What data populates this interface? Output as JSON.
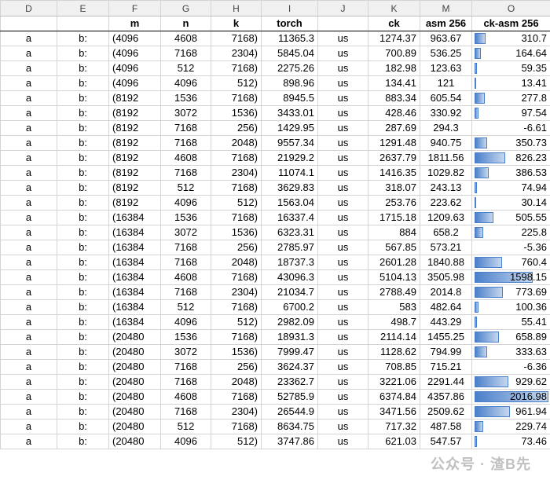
{
  "column_letters": [
    "D",
    "E",
    "F",
    "G",
    "H",
    "I",
    "J",
    "K",
    "M",
    "O"
  ],
  "headers": [
    "",
    "",
    "m",
    "n",
    "k",
    "torch",
    "",
    "ck",
    "asm 256",
    "ck-asm 256"
  ],
  "rows": [
    [
      "a",
      "b:",
      "(4096",
      "4608",
      "7168)",
      "11365.3",
      "us",
      "1274.37",
      "963.67",
      "310.7"
    ],
    [
      "a",
      "b:",
      "(4096",
      "7168",
      "2304)",
      "5845.04",
      "us",
      "700.89",
      "536.25",
      "164.64"
    ],
    [
      "a",
      "b:",
      "(4096",
      "512",
      "7168)",
      "2275.26",
      "us",
      "182.98",
      "123.63",
      "59.35"
    ],
    [
      "a",
      "b:",
      "(4096",
      "4096",
      "512)",
      "898.96",
      "us",
      "134.41",
      "121",
      "13.41"
    ],
    [
      "a",
      "b:",
      "(8192",
      "1536",
      "7168)",
      "8945.5",
      "us",
      "883.34",
      "605.54",
      "277.8"
    ],
    [
      "a",
      "b:",
      "(8192",
      "3072",
      "1536)",
      "3433.01",
      "us",
      "428.46",
      "330.92",
      "97.54"
    ],
    [
      "a",
      "b:",
      "(8192",
      "7168",
      "256)",
      "1429.95",
      "us",
      "287.69",
      "294.3",
      "-6.61"
    ],
    [
      "a",
      "b:",
      "(8192",
      "7168",
      "2048)",
      "9557.34",
      "us",
      "1291.48",
      "940.75",
      "350.73"
    ],
    [
      "a",
      "b:",
      "(8192",
      "4608",
      "7168)",
      "21929.2",
      "us",
      "2637.79",
      "1811.56",
      "826.23"
    ],
    [
      "a",
      "b:",
      "(8192",
      "7168",
      "2304)",
      "11074.1",
      "us",
      "1416.35",
      "1029.82",
      "386.53"
    ],
    [
      "a",
      "b:",
      "(8192",
      "512",
      "7168)",
      "3629.83",
      "us",
      "318.07",
      "243.13",
      "74.94"
    ],
    [
      "a",
      "b:",
      "(8192",
      "4096",
      "512)",
      "1563.04",
      "us",
      "253.76",
      "223.62",
      "30.14"
    ],
    [
      "a",
      "b:",
      "(16384",
      "1536",
      "7168)",
      "16337.4",
      "us",
      "1715.18",
      "1209.63",
      "505.55"
    ],
    [
      "a",
      "b:",
      "(16384",
      "3072",
      "1536)",
      "6323.31",
      "us",
      "884",
      "658.2",
      "225.8"
    ],
    [
      "a",
      "b:",
      "(16384",
      "7168",
      "256)",
      "2785.97",
      "us",
      "567.85",
      "573.21",
      "-5.36"
    ],
    [
      "a",
      "b:",
      "(16384",
      "7168",
      "2048)",
      "18737.3",
      "us",
      "2601.28",
      "1840.88",
      "760.4"
    ],
    [
      "a",
      "b:",
      "(16384",
      "4608",
      "7168)",
      "43096.3",
      "us",
      "5104.13",
      "3505.98",
      "1598.15"
    ],
    [
      "a",
      "b:",
      "(16384",
      "7168",
      "2304)",
      "21034.7",
      "us",
      "2788.49",
      "2014.8",
      "773.69"
    ],
    [
      "a",
      "b:",
      "(16384",
      "512",
      "7168)",
      "6700.2",
      "us",
      "583",
      "482.64",
      "100.36"
    ],
    [
      "a",
      "b:",
      "(16384",
      "4096",
      "512)",
      "2982.09",
      "us",
      "498.7",
      "443.29",
      "55.41"
    ],
    [
      "a",
      "b:",
      "(20480",
      "1536",
      "7168)",
      "18931.3",
      "us",
      "2114.14",
      "1455.25",
      "658.89"
    ],
    [
      "a",
      "b:",
      "(20480",
      "3072",
      "1536)",
      "7999.47",
      "us",
      "1128.62",
      "794.99",
      "333.63"
    ],
    [
      "a",
      "b:",
      "(20480",
      "7168",
      "256)",
      "3624.37",
      "us",
      "708.85",
      "715.21",
      "-6.36"
    ],
    [
      "a",
      "b:",
      "(20480",
      "7168",
      "2048)",
      "23362.7",
      "us",
      "3221.06",
      "2291.44",
      "929.62"
    ],
    [
      "a",
      "b:",
      "(20480",
      "4608",
      "7168)",
      "52785.9",
      "us",
      "6374.84",
      "4357.86",
      "2016.98"
    ],
    [
      "a",
      "b:",
      "(20480",
      "7168",
      "2304)",
      "26544.9",
      "us",
      "3471.56",
      "2509.62",
      "961.94"
    ],
    [
      "a",
      "b:",
      "(20480",
      "512",
      "7168)",
      "8634.75",
      "us",
      "717.32",
      "487.58",
      "229.74"
    ],
    [
      "a",
      "b:",
      "(20480",
      "4096",
      "512)",
      "3747.86",
      "us",
      "621.03",
      "547.57",
      "73.46"
    ]
  ],
  "databar": {
    "column_index": 9,
    "max": 2016.98,
    "color": "#4a7fc9"
  },
  "watermark": "公众号 · 渣B先"
}
